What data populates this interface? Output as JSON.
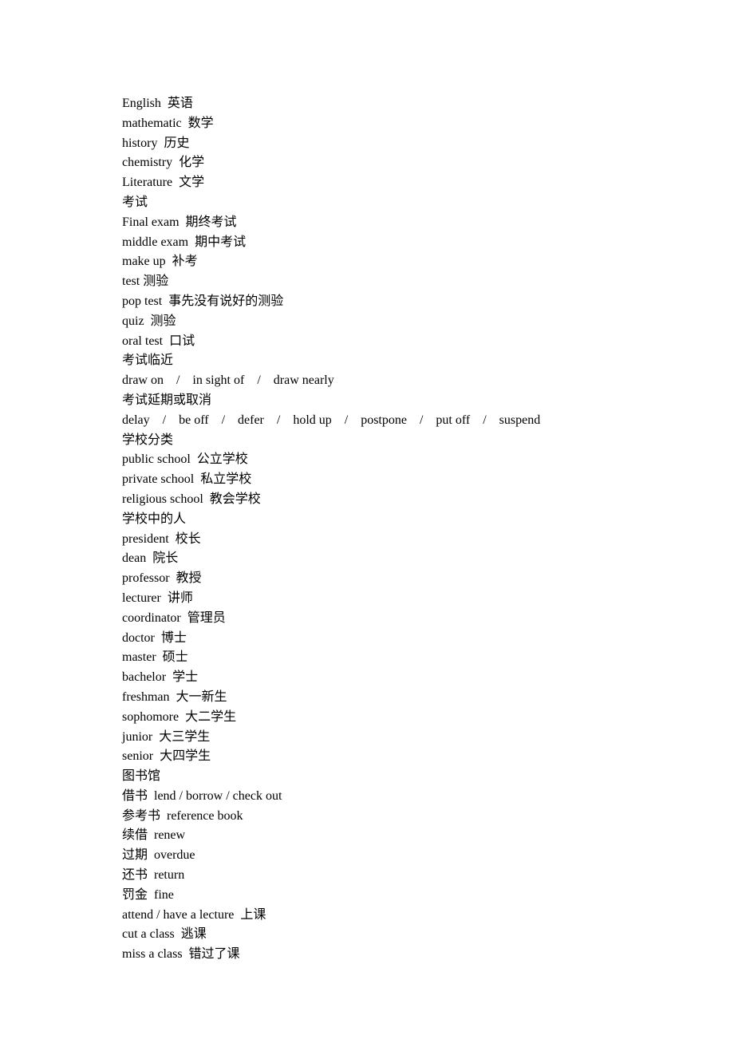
{
  "lines": [
    "English  英语",
    "mathematic  数学",
    "history  历史",
    "chemistry  化学",
    "Literature  文学",
    "考试",
    "Final exam  期终考试",
    "middle exam  期中考试",
    "make up  补考",
    "test 测验",
    "pop test  事先没有说好的测验",
    "quiz  测验",
    "oral test  口试",
    "考试临近",
    "draw on    /    in sight of    /    draw nearly",
    "考试延期或取消",
    "delay    /    be off    /    defer    /    hold up    /    postpone    /    put off    /    suspend",
    "学校分类",
    "public school  公立学校",
    "private school  私立学校",
    "religious school  教会学校",
    "学校中的人",
    "president  校长",
    "dean  院长",
    "professor  教授",
    "lecturer  讲师",
    "coordinator  管理员",
    "doctor  博士",
    "master  硕士",
    "bachelor  学士",
    "freshman  大一新生",
    "sophomore  大二学生",
    "junior  大三学生",
    "senior  大四学生",
    "图书馆",
    "借书  lend / borrow / check out",
    "参考书  reference book",
    "续借  renew",
    "过期  overdue",
    "还书  return",
    "罚金  fine",
    "attend / have a lecture  上课",
    "cut a class  逃课",
    "miss a class  错过了课"
  ]
}
